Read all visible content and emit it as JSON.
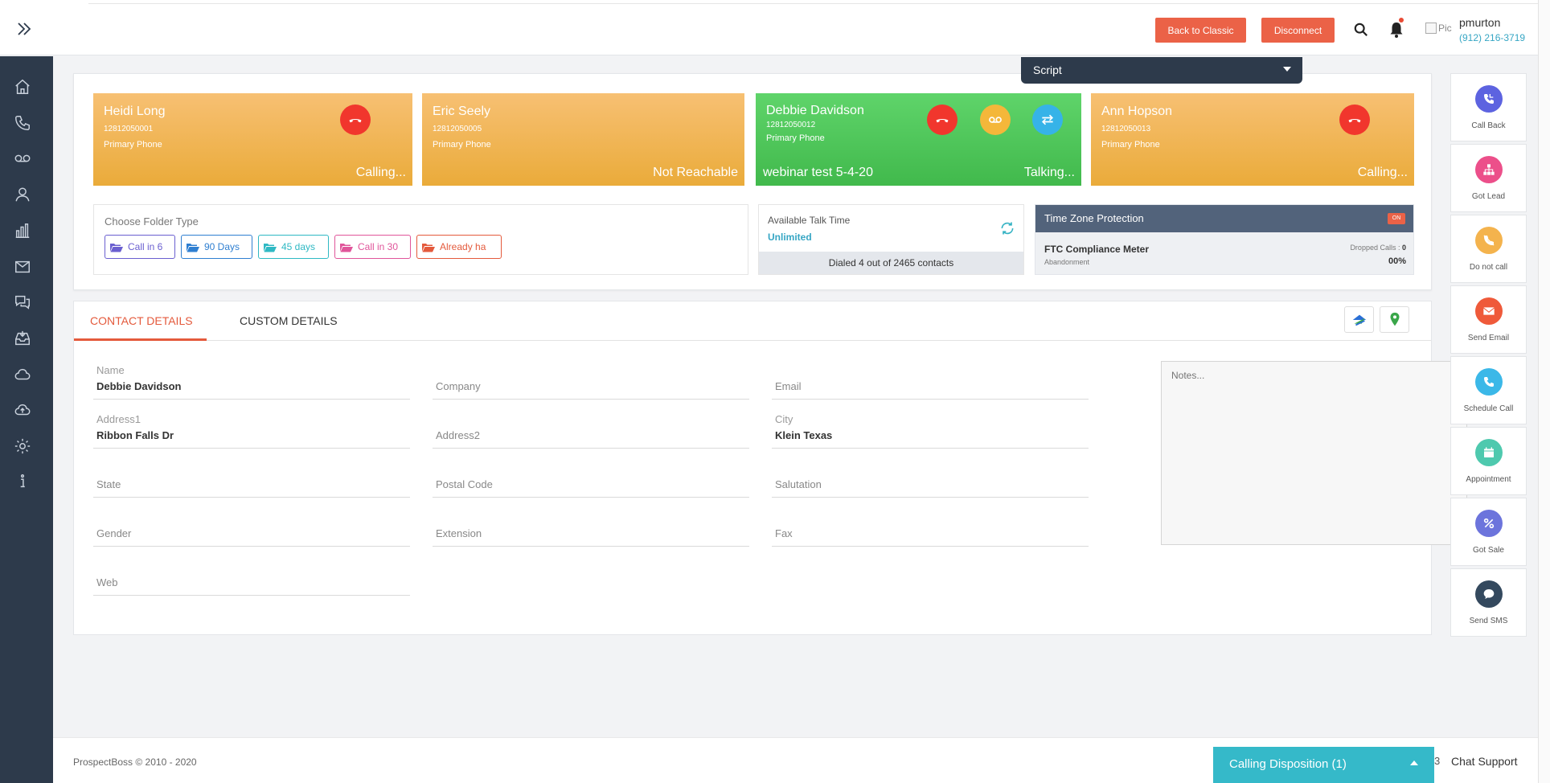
{
  "header": {
    "back_to_classic": "Back to Classic",
    "disconnect": "Disconnect",
    "avatar_alt": "Pic",
    "user_name": "pmurton",
    "user_phone": "(912) 216-3719"
  },
  "script": {
    "label": "Script"
  },
  "lead_cards": [
    {
      "name": "Heidi Long",
      "number": "12812050001",
      "type": "Primary Phone",
      "status": "Calling...",
      "tag": ""
    },
    {
      "name": "Eric Seely",
      "number": "12812050005",
      "type": "Primary Phone",
      "status": "Not Reachable",
      "tag": ""
    },
    {
      "name": "Debbie Davidson",
      "number": "12812050012",
      "type": "Primary Phone",
      "status": "Talking...",
      "tag": "webinar test 5-4-20"
    },
    {
      "name": "Ann Hopson",
      "number": "12812050013",
      "type": "Primary Phone",
      "status": "Calling...",
      "tag": ""
    }
  ],
  "folders": {
    "title": "Choose Folder Type",
    "items": [
      {
        "label": "Call in 6",
        "color": "#6a5fd0"
      },
      {
        "label": "90 Days",
        "color": "#2f7fd1"
      },
      {
        "label": "45 days",
        "color": "#2fb9c4"
      },
      {
        "label": "Call in 30",
        "color": "#e0559a"
      },
      {
        "label": "Already ha",
        "color": "#e45a3c"
      }
    ]
  },
  "talk_time": {
    "title": "Available Talk Time",
    "value": "Unlimited",
    "dialed": "Dialed 4 out of 2465 contacts"
  },
  "timezone": {
    "title": "Time Zone Protection",
    "toggle": "ON",
    "meter": "FTC Compliance Meter",
    "sub": "Abandonment",
    "dropped_label": "Dropped Calls :",
    "dropped_value": "0",
    "percent": "00%"
  },
  "contact": {
    "tab_active": "CONTACT DETAILS",
    "tab_custom": "CUSTOM DETAILS",
    "fields": {
      "name_label": "Name",
      "name_value": "Debbie Davidson",
      "company_label": "Company",
      "email_label": "Email",
      "address1_label": "Address1",
      "address1_value": "Ribbon Falls Dr",
      "address2_label": "Address2",
      "city_label": "City",
      "city_value": "Klein Texas",
      "state_label": "State",
      "postal_label": "Postal Code",
      "salutation_label": "Salutation",
      "gender_label": "Gender",
      "extension_label": "Extension",
      "fax_label": "Fax",
      "web_label": "Web"
    },
    "notes_placeholder": "Notes..."
  },
  "actions": [
    {
      "label": "Call Back",
      "color": "#5d63e0",
      "icon": "phone-callback-icon"
    },
    {
      "label": "Got Lead",
      "color": "#ec4f8a",
      "icon": "sitemap-icon"
    },
    {
      "label": "Do not call",
      "color": "#f4b34d",
      "icon": "phone-slash-icon"
    },
    {
      "label": "Send Email",
      "color": "#ef5a3a",
      "icon": "envelope-icon"
    },
    {
      "label": "Schedule Call",
      "color": "#3bb8e8",
      "icon": "phone-icon"
    },
    {
      "label": "Appointment",
      "color": "#4ec9ae",
      "icon": "calendar-icon"
    },
    {
      "label": "Got Sale",
      "color": "#6c74dc",
      "icon": "percent-icon"
    },
    {
      "label": "Send SMS",
      "color": "#34495e",
      "icon": "chat-icon"
    }
  ],
  "footer": {
    "copyright": "ProspectBoss © 2010 - 2020",
    "disposition": "Calling Disposition (1)",
    "number": "3",
    "chat_support": "Chat Support"
  }
}
